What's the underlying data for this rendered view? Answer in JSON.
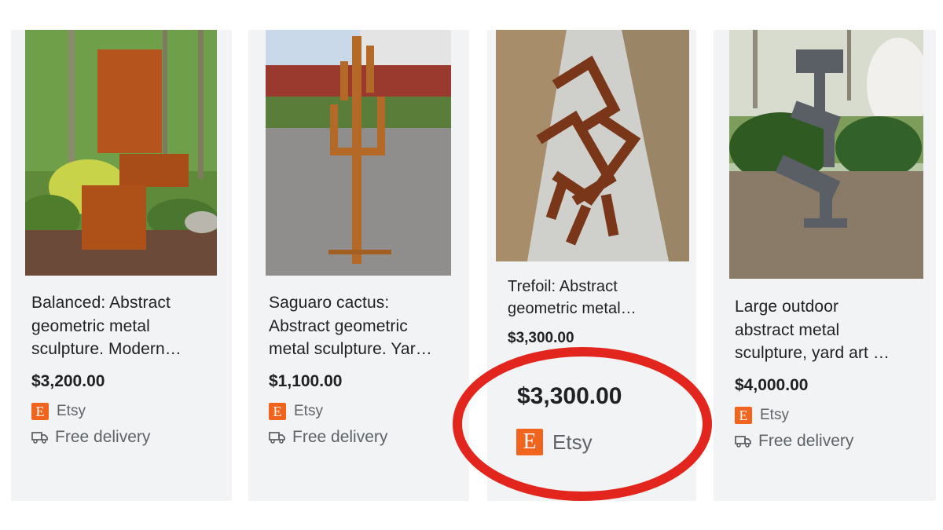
{
  "products": [
    {
      "title_lines": [
        "Balanced: Abstract",
        "geometric metal",
        "sculpture. Modern…"
      ],
      "price": "$3,200.00",
      "seller": "Etsy",
      "delivery": "Free delivery"
    },
    {
      "title_lines": [
        "Saguaro cactus:",
        "Abstract geometric",
        "metal sculpture. Yar…"
      ],
      "price": "$1,100.00",
      "seller": "Etsy",
      "delivery": "Free delivery"
    },
    {
      "title_lines": [
        "Trefoil: Abstract",
        "geometric metal…"
      ],
      "price": "$3,300.00",
      "seller": "Etsy",
      "delivery": ""
    },
    {
      "title_lines": [
        "Large outdoor",
        "abstract metal",
        "sculpture, yard art …"
      ],
      "price": "$4,000.00",
      "seller": "Etsy",
      "delivery": "Free delivery"
    }
  ],
  "highlight": {
    "price": "$3,300.00",
    "seller": "Etsy",
    "ring_color": "#e3261d"
  },
  "brand": {
    "etsy_logo_letter": "E",
    "etsy_color": "#f1641e"
  }
}
